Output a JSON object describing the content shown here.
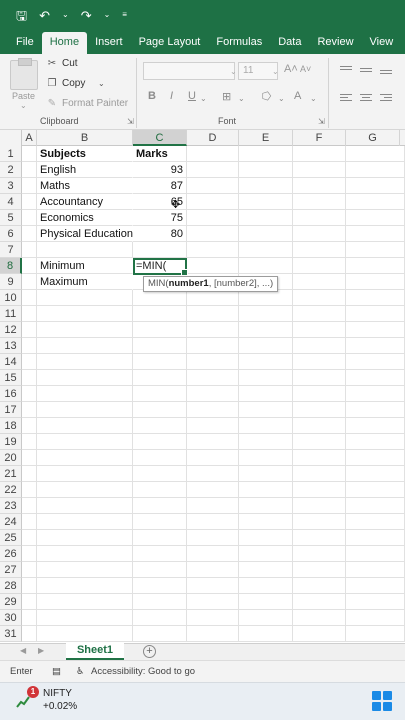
{
  "ribbon_tabs": [
    "File",
    "Home",
    "Insert",
    "Page Layout",
    "Formulas",
    "Data",
    "Review",
    "View"
  ],
  "active_tab": "Home",
  "clipboard": {
    "paste": "Paste",
    "cut": "Cut",
    "copy": "Copy",
    "format_painter": "Format Painter",
    "group_label": "Clipboard"
  },
  "font": {
    "size": "11",
    "group_label": "Font",
    "bold": "B",
    "italic": "I",
    "underline": "U",
    "color_a": "A"
  },
  "columns": [
    "A",
    "B",
    "C",
    "D",
    "E",
    "F",
    "G"
  ],
  "active_column": "C",
  "rows": [
    "1",
    "2",
    "3",
    "4",
    "5",
    "6",
    "7",
    "8",
    "9",
    "10",
    "11",
    "12",
    "13",
    "14",
    "15",
    "16",
    "17",
    "18",
    "19",
    "20",
    "21",
    "22",
    "23",
    "24",
    "25",
    "26",
    "27",
    "28",
    "29",
    "30",
    "31"
  ],
  "active_row": "8",
  "table": {
    "header": {
      "subject": "Subjects",
      "marks": "Marks"
    },
    "entries": [
      {
        "subject": "English",
        "marks": "93"
      },
      {
        "subject": "Maths",
        "marks": "87"
      },
      {
        "subject": "Accountancy",
        "marks": "65"
      },
      {
        "subject": "Economics",
        "marks": "75"
      },
      {
        "subject": "Physical Education",
        "marks": "80"
      }
    ],
    "minimum_label": "Minimum",
    "maximum_label": "Maximum"
  },
  "editing_formula": "=MIN(",
  "tooltip": {
    "fn": "MIN(",
    "arg1": "number1",
    "rest": ", [number2], ...)"
  },
  "sheet_tab": "Sheet1",
  "status": {
    "mode": "Enter",
    "accessibility": "Accessibility: Good to go"
  },
  "taskbar": {
    "badge_count": "1",
    "ticker": "NIFTY",
    "change": "+0.02%"
  },
  "colors": {
    "accent": "#1e7145",
    "selection": "#217346"
  }
}
